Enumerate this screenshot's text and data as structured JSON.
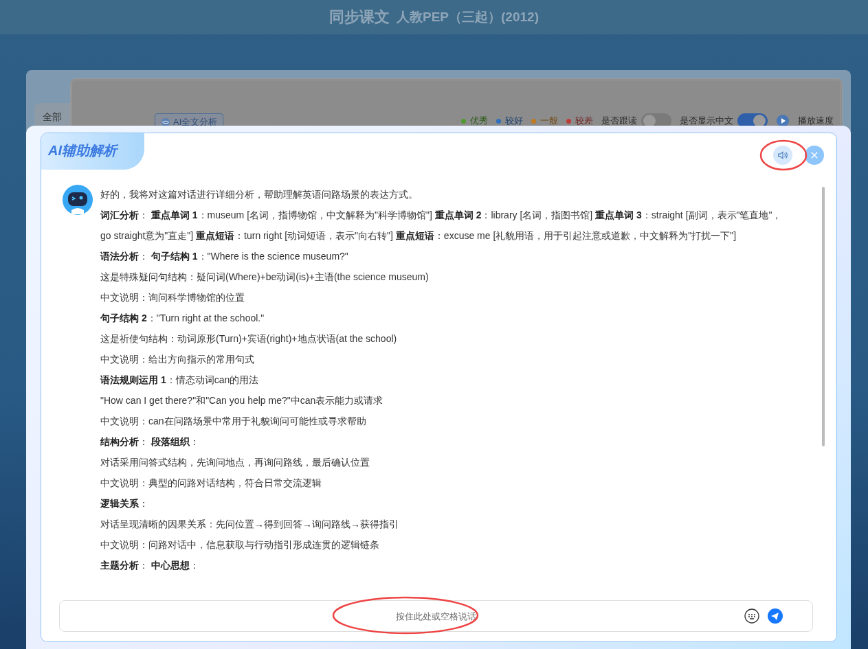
{
  "header": {
    "title": "同步课文",
    "subtitle": "人教PEP（三起）(2012)"
  },
  "background_page": {
    "tab": "全部",
    "ai_button": "AI全文分析",
    "legend": [
      {
        "label": "优秀",
        "color": "#4f9a2e"
      },
      {
        "label": "较好",
        "color": "#2f6fc0"
      },
      {
        "label": "一般",
        "color": "#c07a20"
      },
      {
        "label": "较差",
        "color": "#c03a3a"
      }
    ],
    "toggles": [
      {
        "label": "是否跟读",
        "on": false
      },
      {
        "label": "是否显示中文",
        "on": true
      }
    ],
    "speed_button": "播放速度"
  },
  "dialog": {
    "title": "AI辅助解析",
    "message": [
      "好的，我将对这篇对话进行详细分析，帮助理解英语问路场景的表达方式。",
      "**词汇分析**： **重点单词 1**：museum [名词，指博物馆，中文解释为\"科学博物馆\"] **重点单词 2**：library [名词，指图书馆] **重点单词 3**：straight [副词，表示\"笔直地\"，go straight意为\"直走\"] **重点短语**：turn right [动词短语，表示\"向右转\"] **重点短语**：excuse me [礼貌用语，用于引起注意或道歉，中文解释为\"打扰一下\"]",
      "**语法分析**： **句子结构 1**：\"Where is the science museum?\"",
      "这是特殊疑问句结构：疑问词(Where)+be动词(is)+主语(the science museum)",
      "中文说明：询问科学博物馆的位置",
      "**句子结构 2**：\"Turn right at the school.\"",
      "这是祈使句结构：动词原形(Turn)+宾语(right)+地点状语(at the school)",
      "中文说明：给出方向指示的常用句式",
      "**语法规则运用 1**：情态动词can的用法",
      "\"How can I get there?\"和\"Can you help me?\"中can表示能力或请求",
      "中文说明：can在问路场景中常用于礼貌询问可能性或寻求帮助",
      "**结构分析**： **段落组织**：",
      "对话采用问答式结构，先询问地点，再询问路线，最后确认位置",
      "中文说明：典型的问路对话结构，符合日常交流逻辑",
      "**逻辑关系**：",
      "对话呈现清晰的因果关系：先问位置→得到回答→询问路线→获得指引",
      "中文说明：问路对话中，信息获取与行动指引形成连贯的逻辑链条",
      "**主题分析**： **中心思想**："
    ],
    "input": {
      "placeholder": "按住此处或空格说话"
    }
  }
}
